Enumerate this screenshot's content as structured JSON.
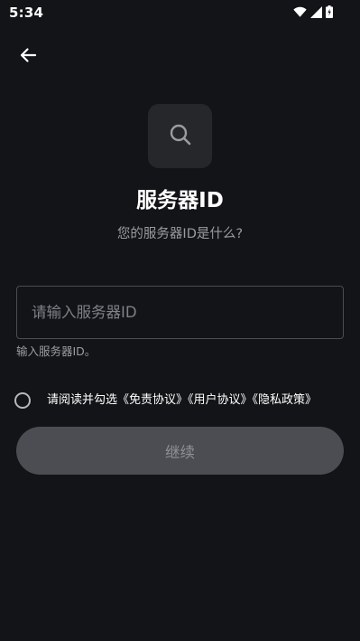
{
  "status_bar": {
    "time": "5:34",
    "icons": [
      "wifi-icon",
      "cellular-signal-icon",
      "battery-icon"
    ]
  },
  "header": {
    "back_icon": "arrow-left-icon"
  },
  "hero": {
    "icon": "search-icon",
    "title": "服务器ID",
    "subtitle": "您的服务器ID是什么?"
  },
  "form": {
    "server_id": {
      "value": "",
      "placeholder": "请输入服务器ID",
      "helper": "输入服务器ID。"
    },
    "agreement": {
      "checked": false,
      "prefix": "请阅读并勾选",
      "terms_link": "《免责协议》",
      "user_link": "《用户协议》",
      "privacy_link": "《隐私政策》"
    },
    "continue_label": "继续"
  },
  "colors": {
    "background": "#121417",
    "card": "#25272b",
    "muted_text": "#9a9ca1",
    "button_disabled": "#4b4d52",
    "button_text_disabled": "#8e9095",
    "field_border": "#4a4d52"
  }
}
